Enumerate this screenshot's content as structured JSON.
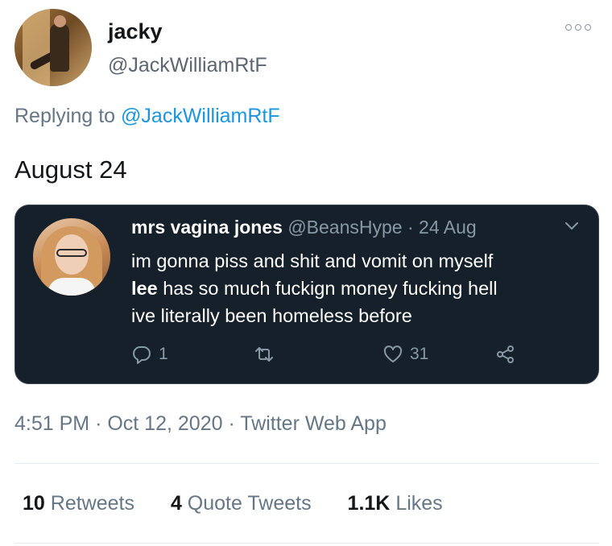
{
  "author": {
    "name": "jacky",
    "handle": "@JackWilliamRtF"
  },
  "reply": {
    "prefix": "Replying to",
    "mention": "@JackWilliamRtF"
  },
  "tweet": {
    "text": "August 24"
  },
  "quote": {
    "name": "mrs vagina jones",
    "handle": "@BeansHype",
    "separator": "·",
    "date": "24 Aug",
    "lines": [
      {
        "bold": "",
        "text": "im gonna piss and shit and vomit on myself"
      },
      {
        "bold": "lee",
        "text": " has so much fuckign money fucking hell"
      },
      {
        "bold": "",
        "text": "ive literally been homeless before"
      }
    ],
    "actions": {
      "replies": "1",
      "retweets": "",
      "likes": "31"
    }
  },
  "meta": {
    "time": "4:51 PM",
    "sep1": "·",
    "date": "Oct 12, 2020",
    "sep2": "·",
    "source": "Twitter Web App"
  },
  "stats": {
    "retweets_count": "10",
    "retweets_label": "Retweets",
    "quotes_count": "4",
    "quotes_label": "Quote Tweets",
    "likes_count": "1.1K",
    "likes_label": "Likes"
  },
  "colors": {
    "link": "#1b95e0",
    "quote_bg": "#15202b",
    "muted": "#657786"
  },
  "icons": [
    "more-icon",
    "chevron-down-icon",
    "reply-icon",
    "retweet-icon",
    "like-icon",
    "share-icon"
  ]
}
